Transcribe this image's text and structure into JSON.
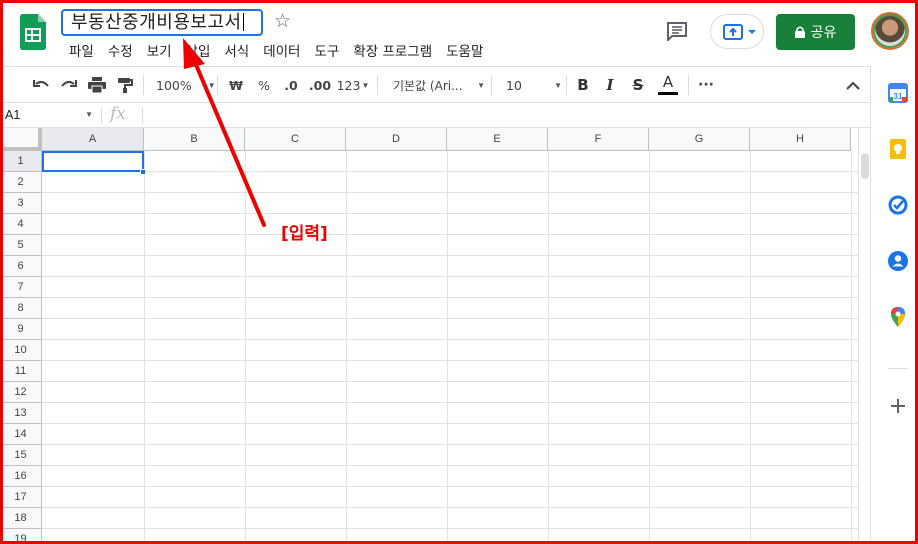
{
  "document": {
    "title": "부동산중개비용보고서"
  },
  "menu": [
    "파일",
    "수정",
    "보기",
    "삽입",
    "서식",
    "데이터",
    "도구",
    "확장 프로그램",
    "도움말"
  ],
  "header": {
    "share_label": "공유",
    "share_color": "#188038"
  },
  "toolbar": {
    "zoom": "100%",
    "currency": "₩",
    "percent": "%",
    "decimal_decrease": ".0",
    "decimal_increase": ".00",
    "number_format": "123",
    "font_family": "기본값 (Ari...",
    "font_size": "10",
    "bold": "B",
    "italic": "I",
    "strike": "S",
    "text_color": "A",
    "more": "···"
  },
  "formula_bar": {
    "cell_ref": "A1",
    "fx": "fx"
  },
  "columns": [
    "A",
    "B",
    "C",
    "D",
    "E",
    "F",
    "G",
    "H"
  ],
  "rows": [
    "1",
    "2",
    "3",
    "4",
    "5",
    "6",
    "7",
    "8",
    "9",
    "10",
    "11",
    "12",
    "13",
    "14",
    "15",
    "16",
    "17",
    "18",
    "19"
  ],
  "selected_cell": "A1",
  "annotation": {
    "label": "[입력]",
    "color": "#e00000"
  }
}
